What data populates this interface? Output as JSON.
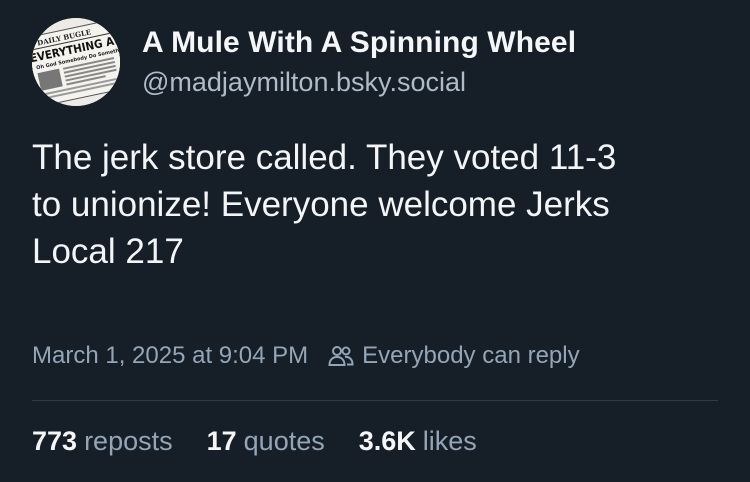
{
  "author": {
    "display_name": "A Mule With A Spinning Wheel",
    "handle": "@madjaymilton.bsky.social",
    "avatar": {
      "icon": "newspaper-avatar",
      "headline": "EVERYTHING AWFUL",
      "masthead": "DAILY BUGLE",
      "subhead": "Oh God Somebody Do Something"
    }
  },
  "post": {
    "text_lines": [
      "The jerk store called. They voted 11-3",
      "to unionize! Everyone welcome Jerks",
      "Local 217"
    ]
  },
  "meta": {
    "timestamp": "March 1, 2025 at 9:04 PM",
    "reply_icon": "people-icon",
    "reply_setting": "Everybody can reply"
  },
  "stats": {
    "reposts_count": "773",
    "reposts_label": "reposts",
    "quotes_count": "17",
    "quotes_label": "quotes",
    "likes_count": "3.6K",
    "likes_label": "likes"
  }
}
